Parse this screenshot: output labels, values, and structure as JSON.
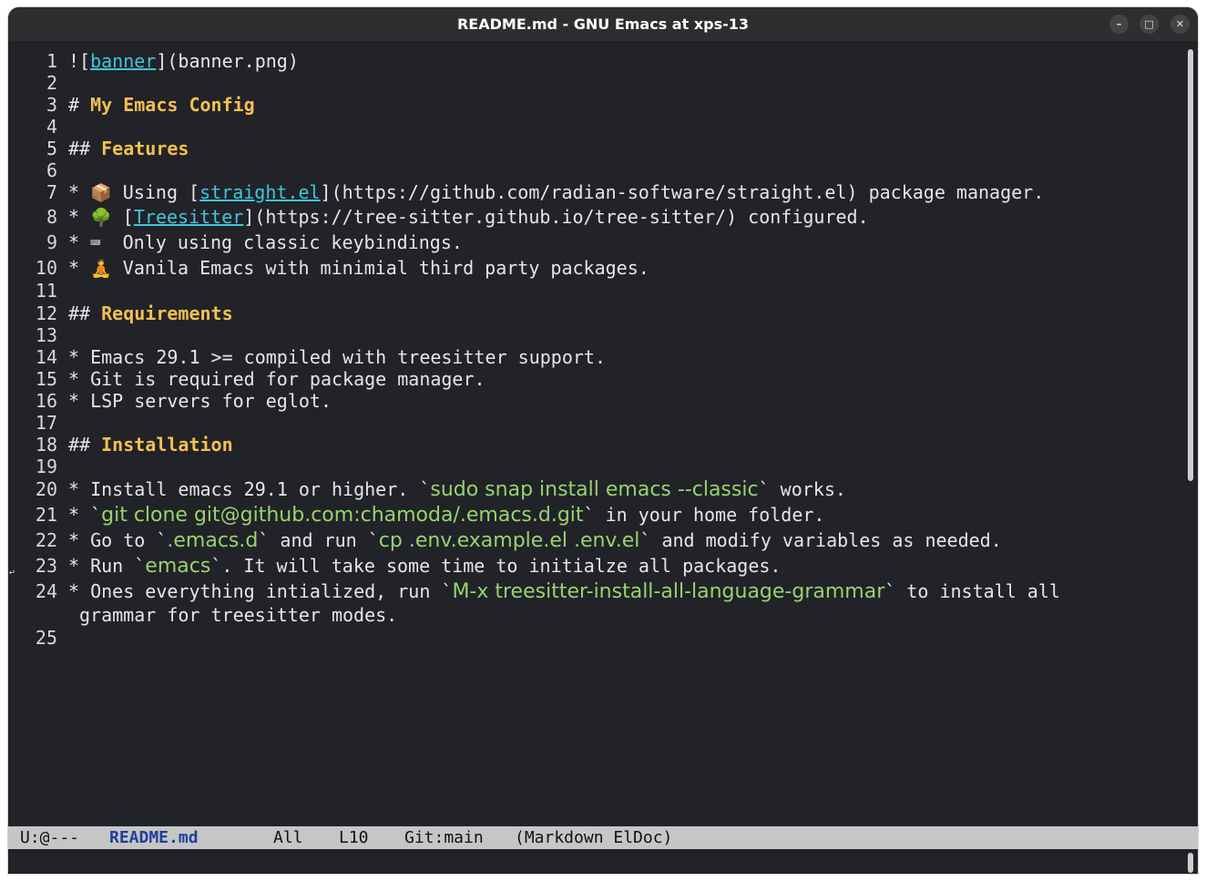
{
  "window": {
    "title": "README.md - GNU Emacs at xps-13"
  },
  "controls": {
    "minimize": "–",
    "maximize": "□",
    "close": "✕"
  },
  "editor": {
    "lines": [
      {
        "n": "1",
        "segs": [
          {
            "t": "!["
          },
          {
            "t": "banner",
            "c": "link"
          },
          {
            "t": "](banner.png)"
          }
        ]
      },
      {
        "n": "2",
        "segs": []
      },
      {
        "n": "3",
        "segs": [
          {
            "t": "# "
          },
          {
            "t": "My Emacs Config",
            "c": "head"
          }
        ]
      },
      {
        "n": "4",
        "segs": []
      },
      {
        "n": "5",
        "segs": [
          {
            "t": "## "
          },
          {
            "t": "Features",
            "c": "head"
          }
        ]
      },
      {
        "n": "6",
        "segs": []
      },
      {
        "n": "7",
        "segs": [
          {
            "t": "* "
          },
          {
            "t": "📦",
            "c": "em"
          },
          {
            "t": " Using ["
          },
          {
            "t": "straight.el",
            "c": "link"
          },
          {
            "t": "](https://github.com/radian-software/straight.el) package manager."
          }
        ]
      },
      {
        "n": "8",
        "segs": [
          {
            "t": "* "
          },
          {
            "t": "🌳",
            "c": "em"
          },
          {
            "t": " ["
          },
          {
            "t": "Treesitter",
            "c": "link"
          },
          {
            "t": "](https://tree-sitter.github.io/tree-sitter/) configured."
          }
        ]
      },
      {
        "n": "9",
        "segs": [
          {
            "t": "* "
          },
          {
            "t": "⌨",
            "c": "em"
          },
          {
            "t": "  Only using classic keybindings."
          }
        ]
      },
      {
        "n": "10",
        "segs": [
          {
            "t": "* "
          },
          {
            "t": "🧘",
            "c": "em"
          },
          {
            "t": " Vanila Emacs with minimial third party packages."
          }
        ]
      },
      {
        "n": "11",
        "segs": []
      },
      {
        "n": "12",
        "segs": [
          {
            "t": "## "
          },
          {
            "t": "Requirements",
            "c": "head"
          }
        ]
      },
      {
        "n": "13",
        "segs": []
      },
      {
        "n": "14",
        "segs": [
          {
            "t": "* Emacs 29.1 >= compiled with treesitter support."
          }
        ]
      },
      {
        "n": "15",
        "segs": [
          {
            "t": "* Git is required for package manager."
          }
        ]
      },
      {
        "n": "16",
        "segs": [
          {
            "t": "* LSP servers for eglot."
          }
        ]
      },
      {
        "n": "17",
        "segs": []
      },
      {
        "n": "18",
        "segs": [
          {
            "t": "## "
          },
          {
            "t": "Installation",
            "c": "head"
          }
        ]
      },
      {
        "n": "19",
        "segs": []
      },
      {
        "n": "20",
        "segs": [
          {
            "t": "* Install emacs 29.1 or higher. `"
          },
          {
            "t": "sudo snap install emacs --classic",
            "c": "code"
          },
          {
            "t": "` works."
          }
        ]
      },
      {
        "n": "21",
        "segs": [
          {
            "t": "* `"
          },
          {
            "t": "git clone git@github.com:chamoda/.emacs.d.git",
            "c": "code"
          },
          {
            "t": "` in your home folder."
          }
        ]
      },
      {
        "n": "22",
        "segs": [
          {
            "t": "* Go to `"
          },
          {
            "t": ".emacs.d",
            "c": "code"
          },
          {
            "t": "` and run `"
          },
          {
            "t": "cp .env.example.el .env.el",
            "c": "code"
          },
          {
            "t": "` and modify variables as needed."
          }
        ]
      },
      {
        "n": "23",
        "segs": [
          {
            "t": "* Run `"
          },
          {
            "t": "emacs",
            "c": "code"
          },
          {
            "t": "`. It will take some time to initialze all packages."
          }
        ]
      },
      {
        "n": "24",
        "segs": [
          {
            "t": "* Ones everything intialized, run `"
          },
          {
            "t": "M-x treesitter-install-all-language-grammar",
            "c": "code"
          },
          {
            "t": "` to install all"
          }
        ]
      },
      {
        "n": "",
        "segs": [
          {
            "t": "grammar for treesitter modes."
          }
        ]
      },
      {
        "n": "25",
        "segs": []
      }
    ]
  },
  "modeline": {
    "status": "U:@---",
    "buffer": "README.md",
    "position": "All",
    "line": "L10",
    "vc": "Git:main",
    "modes": "(Markdown ElDoc)"
  },
  "fringe": {
    "wrap_left": "↩",
    "wrap_right": "↪"
  }
}
